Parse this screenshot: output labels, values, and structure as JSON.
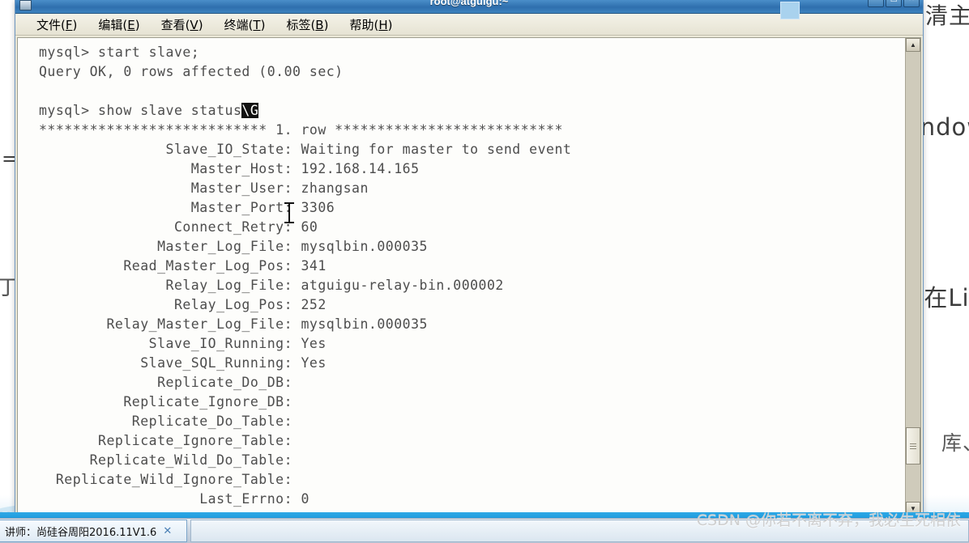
{
  "background_slide": {
    "right_fragments": [
      "清主",
      "ndow",
      "在Lin",
      "库、"
    ],
    "left_fragments": [
      "=",
      "丁"
    ]
  },
  "window": {
    "title": "root@atguigu:~",
    "icon": "terminal-icon",
    "buttons": {
      "minimize": "–",
      "maximize": "□",
      "close": "✕"
    },
    "menu": [
      {
        "label": "文件",
        "accel": "F"
      },
      {
        "label": "编辑",
        "accel": "E"
      },
      {
        "label": "查看",
        "accel": "V"
      },
      {
        "label": "终端",
        "accel": "T"
      },
      {
        "label": "标签",
        "accel": "B"
      },
      {
        "label": "帮助",
        "accel": "H"
      }
    ]
  },
  "terminal": {
    "lines": [
      {
        "text": "mysql> start slave;"
      },
      {
        "text": "Query OK, 0 rows affected (0.00 sec)"
      },
      {
        "text": ""
      },
      {
        "text": "mysql> show slave status",
        "inverse": "\\G"
      },
      {
        "text": "*************************** 1. row ***************************"
      },
      {
        "text": "               Slave_IO_State: Waiting for master to send event"
      },
      {
        "text": "                  Master_Host: 192.168.14.165"
      },
      {
        "text": "                  Master_User: zhangsan"
      },
      {
        "text": "                  Master_Port: 3306"
      },
      {
        "text": "                Connect_Retry: 60"
      },
      {
        "text": "              Master_Log_File: mysqlbin.000035"
      },
      {
        "text": "          Read_Master_Log_Pos: 341"
      },
      {
        "text": "               Relay_Log_File: atguigu-relay-bin.000002"
      },
      {
        "text": "                Relay_Log_Pos: 252"
      },
      {
        "text": "        Relay_Master_Log_File: mysqlbin.000035"
      },
      {
        "text": "             Slave_IO_Running: Yes"
      },
      {
        "text": "            Slave_SQL_Running: Yes"
      },
      {
        "text": "              Replicate_Do_DB: "
      },
      {
        "text": "          Replicate_Ignore_DB: "
      },
      {
        "text": "           Replicate_Do_Table: "
      },
      {
        "text": "       Replicate_Ignore_Table: "
      },
      {
        "text": "      Replicate_Wild_Do_Table: "
      },
      {
        "text": "  Replicate_Wild_Ignore_Table: "
      },
      {
        "text": "                   Last_Errno: 0"
      }
    ],
    "scrollbar": {
      "up_arrow": "▲",
      "down_arrow": "▼"
    }
  },
  "taskbar": {
    "item_label": "讲师：尚硅谷周阳2016.11V1.6",
    "close_label": "✕"
  },
  "watermark": "CSDN @你若不离不弃，我必生死相依"
}
